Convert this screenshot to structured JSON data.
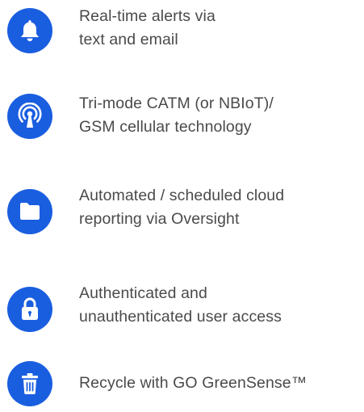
{
  "accent_color": "#1a5ee0",
  "text_color": "#4a4a4a",
  "features": [
    {
      "icon": "bell-icon",
      "lines": [
        "Real-time alerts via",
        "text and email"
      ]
    },
    {
      "icon": "broadcast-tower-icon",
      "lines": [
        "Tri-mode CATM (or NBIoT)/",
        "GSM cellular technology"
      ]
    },
    {
      "icon": "folder-icon",
      "lines": [
        "Automated / scheduled cloud",
        "reporting via Oversight"
      ]
    },
    {
      "icon": "lock-icon",
      "lines": [
        "Authenticated and",
        "unauthenticated user access"
      ]
    },
    {
      "icon": "trash-icon",
      "lines": [
        "Recycle with GO GreenSense™"
      ]
    }
  ]
}
